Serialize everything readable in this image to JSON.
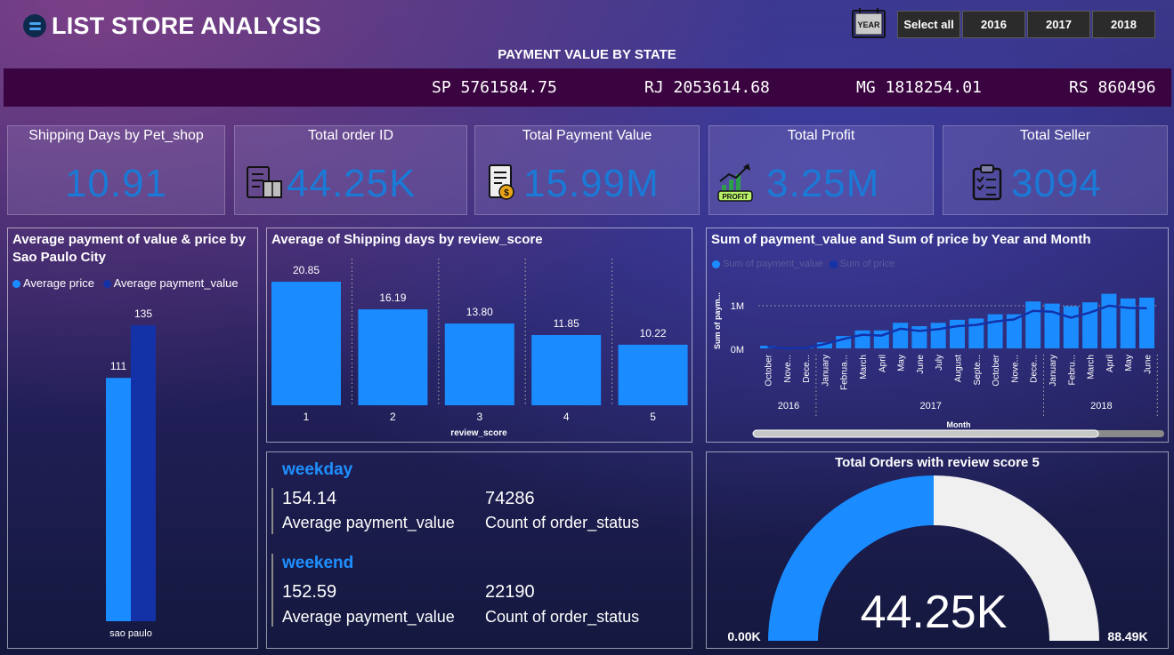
{
  "header": {
    "title": "LIST STORE ANALYSIS",
    "year_icon_label": "YEAR",
    "slicers": [
      "Select all",
      "2016",
      "2017",
      "2018"
    ]
  },
  "state_ribbon": {
    "title": "PAYMENT VALUE BY STATE",
    "items": [
      "SP 5761584.75",
      "RJ 2053614.68",
      "MG 1818254.01",
      "RS 860496"
    ]
  },
  "kpis": [
    {
      "title": "Shipping Days by Pet_shop",
      "value": "10.91",
      "icon": "none"
    },
    {
      "title": "Total order ID",
      "value": "44.25K",
      "icon": "order-box-icon"
    },
    {
      "title": "Total Payment Value",
      "value": "15.99M",
      "icon": "invoice-coin-icon"
    },
    {
      "title": "Total Profit",
      "value": "3.25M",
      "icon": "profit-chart-icon",
      "icon_label": "PROFIT"
    },
    {
      "title": "Total Seller",
      "value": "3094",
      "icon": "clipboard-checklist-icon"
    }
  ],
  "colors": {
    "accent": "#1a8cff",
    "dark_series": "#1432a8",
    "gauge_rest": "#f0f0f0",
    "ribbon": "#3a0440"
  },
  "chart_data": [
    {
      "type": "bar",
      "title": "Average payment of value & price by Sao Paulo City",
      "categories": [
        "sao paulo"
      ],
      "series": [
        {
          "name": "Average price",
          "values": [
            111
          ],
          "labels": [
            "111"
          ]
        },
        {
          "name": "Average payment_value",
          "values": [
            135
          ],
          "labels": [
            "135"
          ]
        }
      ],
      "ylim": [
        0,
        135
      ]
    },
    {
      "type": "bar",
      "title": "Average of Shipping days by review_score",
      "xlabel": "review_score",
      "categories": [
        "1",
        "2",
        "3",
        "4",
        "5"
      ],
      "values": [
        20.85,
        16.19,
        13.8,
        11.85,
        10.22
      ],
      "labels": [
        "20.85",
        "16.19",
        "13.80",
        "11.85",
        "10.22"
      ],
      "ylim": [
        0,
        20.85
      ]
    },
    {
      "type": "bar",
      "title": "Sum of payment_value and Sum of price by Year and Month",
      "xlabel": "Month",
      "ylabel": "Sum of paym...",
      "ytick_labels": [
        "1M",
        "0M"
      ],
      "scroll_thumb": 0.84,
      "years": [
        {
          "label": "2016",
          "months": 3
        },
        {
          "label": "2017",
          "months": 12
        },
        {
          "label": "2018",
          "months": 6
        }
      ],
      "categories": [
        "October",
        "Nove...",
        "Dece...",
        "January",
        "Februa...",
        "March",
        "April",
        "May",
        "June",
        "July",
        "August",
        "Septe...",
        "October",
        "Nove...",
        "Dece...",
        "January",
        "Febru...",
        "March",
        "April",
        "May",
        "June"
      ],
      "series": [
        {
          "name": "Sum of payment_value",
          "values": [
            0.06,
            0,
            0.02,
            0.14,
            0.29,
            0.42,
            0.42,
            0.6,
            0.52,
            0.6,
            0.67,
            0.7,
            0.8,
            0.8,
            1.1,
            1.05,
            0.99,
            1.08,
            1.28,
            1.17,
            1.19
          ]
        },
        {
          "name": "Sum of price",
          "values": [
            0.04,
            0,
            0.01,
            0.1,
            0.22,
            0.32,
            0.3,
            0.46,
            0.41,
            0.45,
            0.52,
            0.55,
            0.63,
            0.68,
            0.88,
            0.86,
            0.72,
            0.84,
            1.0,
            0.95,
            0.94
          ]
        }
      ],
      "ylim": [
        0,
        1.5
      ]
    },
    {
      "type": "gauge",
      "title": "Total Orders with review score 5",
      "value": 44.25,
      "min": 0,
      "max": 88.49,
      "value_label": "44.25K",
      "min_label": "0.00K",
      "max_label": "88.49K"
    }
  ],
  "weekday": {
    "head": "weekday",
    "avg_value": "154.14",
    "avg_label": "Average payment_value",
    "count_value": "74286",
    "count_label": "Count of order_status"
  },
  "weekend": {
    "head": "weekend",
    "avg_value": "152.59",
    "avg_label": "Average payment_value",
    "count_value": "22190",
    "count_label": "Count of order_status"
  }
}
